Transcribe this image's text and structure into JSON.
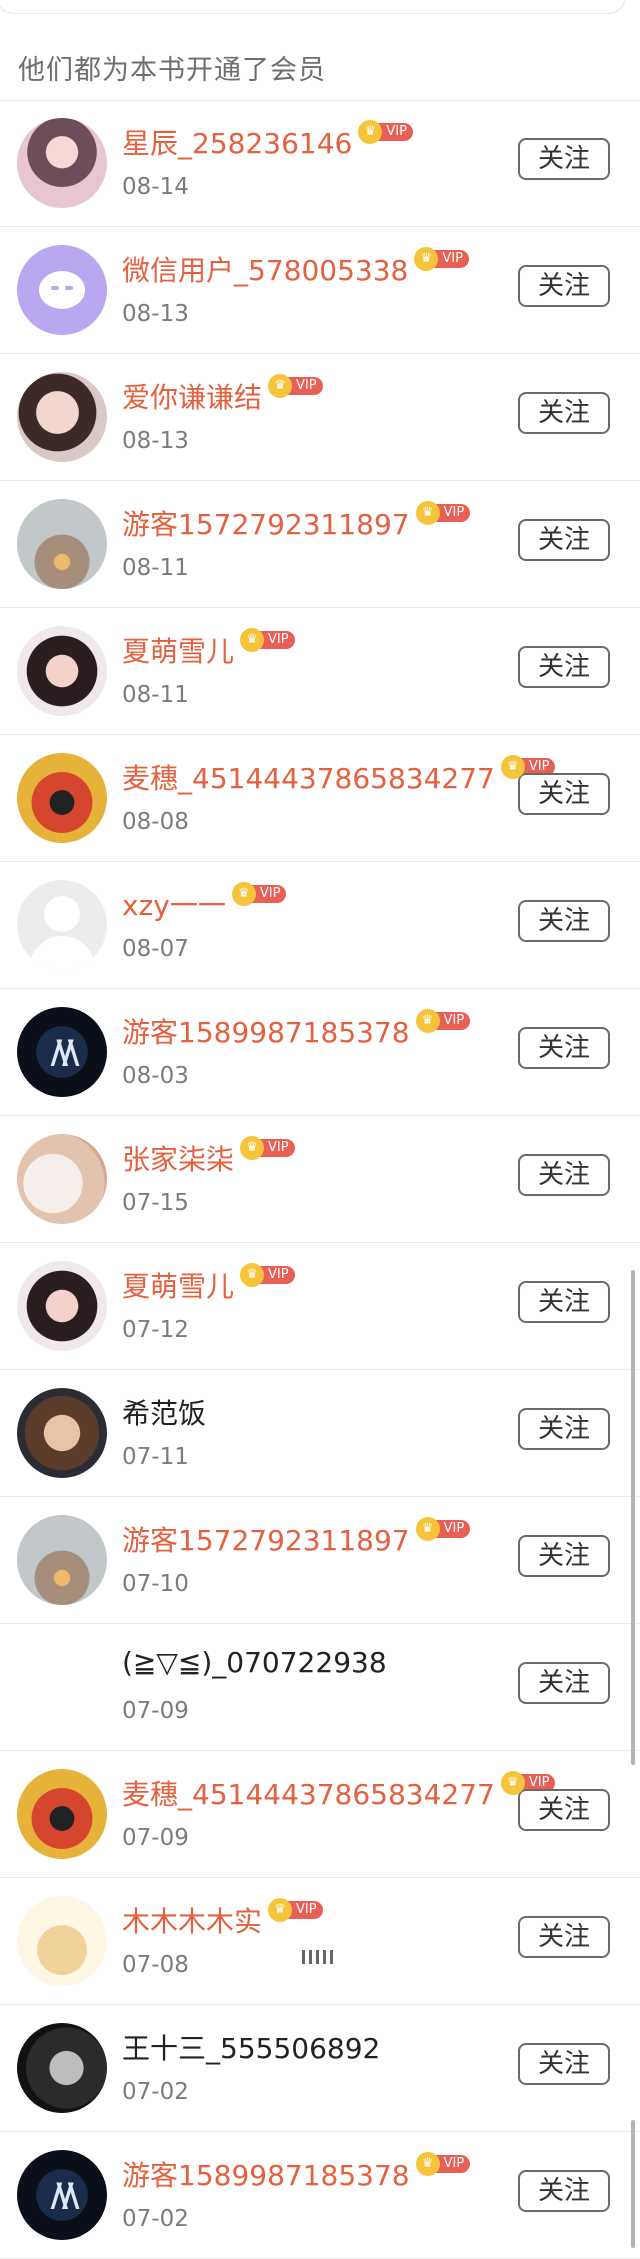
{
  "header": {
    "title": "他们都为本书开通了会员"
  },
  "follow_label": "关注",
  "vip_label": "VIP",
  "vip_crown": "♛",
  "walker_logo_text": "/\\/\\",
  "colors": {
    "vip_name": "#e5603f",
    "vip_tag": "#e95f55",
    "vip_crown": "#f6c43a"
  },
  "members": [
    {
      "name": "星辰_258236146",
      "date": "08-14",
      "vip": true,
      "avatar": "anime-girl"
    },
    {
      "name": "微信用户_578005338",
      "date": "08-13",
      "vip": true,
      "avatar": "wechat-default"
    },
    {
      "name": "爱你谦谦结",
      "date": "08-13",
      "vip": true,
      "avatar": "girl-photo"
    },
    {
      "name": "游客1572792311897",
      "date": "08-11",
      "vip": true,
      "avatar": "sky-photo"
    },
    {
      "name": "夏萌雪儿",
      "date": "08-11",
      "vip": true,
      "avatar": "girl-photo-2"
    },
    {
      "name": "麦穗_45144437865834277",
      "date": "08-08",
      "vip": true,
      "avatar": "crowd-photo"
    },
    {
      "name": "xzy一一",
      "date": "08-07",
      "vip": true,
      "avatar": "default-person"
    },
    {
      "name": "游客1589987185378",
      "date": "08-03",
      "vip": true,
      "avatar": "alan-walker-logo"
    },
    {
      "name": "张家柒柒",
      "date": "07-15",
      "vip": true,
      "avatar": "cat-photo"
    },
    {
      "name": "夏萌雪儿",
      "date": "07-12",
      "vip": true,
      "avatar": "girl-photo-2"
    },
    {
      "name": "希范饭",
      "date": "07-11",
      "vip": false,
      "avatar": "boy-photo"
    },
    {
      "name": "游客1572792311897",
      "date": "07-10",
      "vip": true,
      "avatar": "sky-photo"
    },
    {
      "name": "(≧▽≦)_070722938",
      "date": "07-09",
      "vip": false,
      "avatar": "blank"
    },
    {
      "name": "麦穗_45144437865834277",
      "date": "07-09",
      "vip": true,
      "avatar": "crowd-photo"
    },
    {
      "name": "木木木木实",
      "date": "07-08",
      "vip": true,
      "avatar": "teapot-cartoon"
    },
    {
      "name": "王十三_555506892",
      "date": "07-02",
      "vip": false,
      "avatar": "bw-photo"
    },
    {
      "name": "游客1589987185378",
      "date": "07-02",
      "vip": true,
      "avatar": "alan-walker-logo"
    }
  ]
}
